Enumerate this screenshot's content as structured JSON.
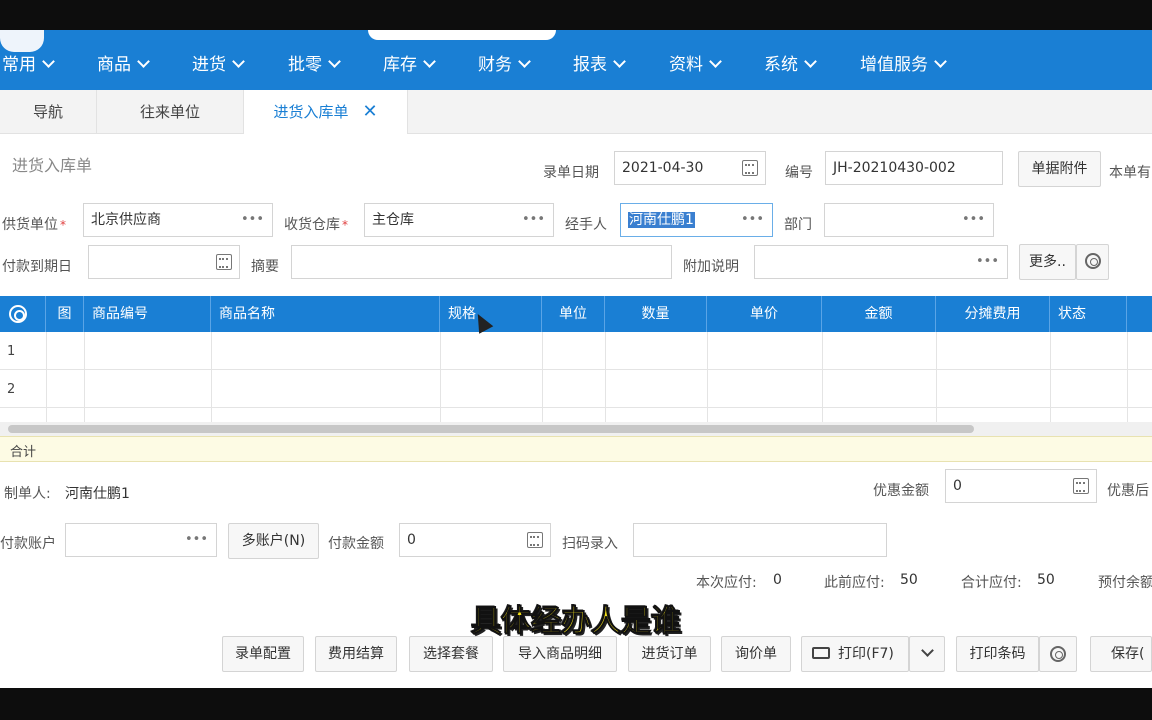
{
  "menu": {
    "items": [
      {
        "label": "常用"
      },
      {
        "label": "商品"
      },
      {
        "label": "进货"
      },
      {
        "label": "批零"
      },
      {
        "label": "库存"
      },
      {
        "label": "财务"
      },
      {
        "label": "报表"
      },
      {
        "label": "资料"
      },
      {
        "label": "系统"
      },
      {
        "label": "增值服务"
      }
    ]
  },
  "tabs": [
    {
      "label": "导航",
      "active": false
    },
    {
      "label": "往来单位",
      "active": false
    },
    {
      "label": "进货入库单",
      "active": true,
      "closable": true
    }
  ],
  "form": {
    "title": "进货入库单",
    "record_date_label": "录单日期",
    "record_date": "2021-04-30",
    "number_label": "编号",
    "number": "JH-20210430-002",
    "attachment_button": "单据附件",
    "truncated_right_label": "本单有",
    "supplier_label": "供货单位",
    "supplier": "北京供应商",
    "warehouse_label": "收货仓库",
    "warehouse": "主仓库",
    "handler_label": "经手人",
    "handler": "河南仕鹏1",
    "department_label": "部门",
    "department": "",
    "due_date_label": "付款到期日",
    "due_date": "",
    "summary_label": "摘要",
    "summary": "",
    "extra_note_label": "附加说明",
    "extra_note": "",
    "more_button": "更多..",
    "required_mark": "*"
  },
  "grid": {
    "columns": [
      "图",
      "商品编号",
      "商品名称",
      "规格",
      "单位",
      "数量",
      "单价",
      "金额",
      "分摊费用",
      "状态"
    ],
    "rows": [
      {
        "num": "1"
      },
      {
        "num": "2"
      }
    ],
    "total_label": "合计"
  },
  "footer": {
    "creator_label": "制单人:",
    "creator": "河南仕鹏1",
    "discount_amount_label": "优惠金额",
    "discount_amount": "0",
    "after_discount_label": "优惠后",
    "pay_account_label": "付款账户",
    "pay_account": "",
    "multi_account_button": "多账户(N)",
    "pay_amount_label": "付款金额",
    "pay_amount": "0",
    "scan_label": "扫码录入",
    "scan_value": "",
    "payable_current_label": "本次应付:",
    "payable_current": "0",
    "payable_prev_label": "此前应付:",
    "payable_prev": "50",
    "payable_total_label": "合计应付:",
    "payable_total": "50",
    "prepaid_label": "预付余额"
  },
  "actions": {
    "config": "录单配置",
    "fee_settle": "费用结算",
    "select_package": "选择套餐",
    "import_detail": "导入商品明细",
    "purchase_order": "进货订单",
    "inquiry": "询价单",
    "print": "打印(F7)",
    "print_barcode": "打印条码",
    "save": "保存("
  },
  "subtitle": "具体经办人是谁",
  "colors": {
    "menu_bg": "#1a7fd4",
    "grid_header_bg": "#1a7fd4",
    "active_tab_text": "#1a7fd4",
    "subtitle": "#f5e21a",
    "required": "#e04040",
    "sum_row_bg": "#fdfbe4"
  }
}
